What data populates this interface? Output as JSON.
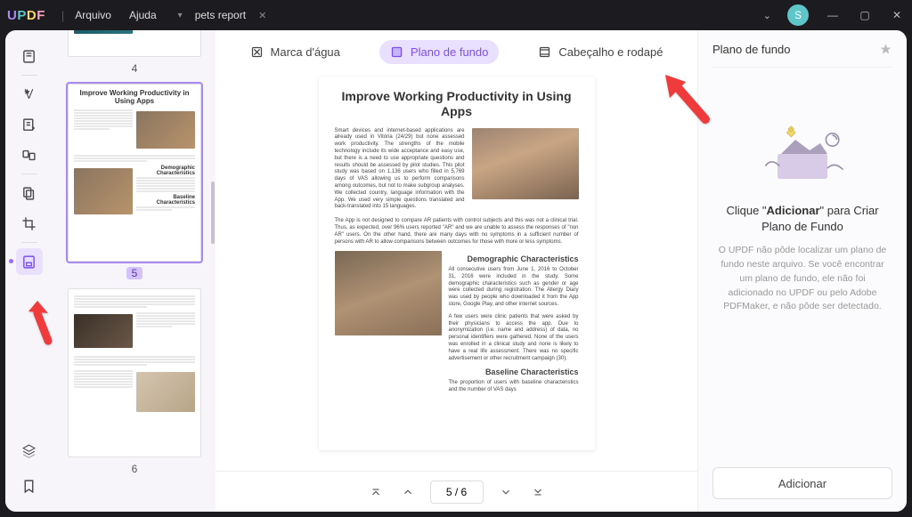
{
  "app": {
    "logo": "UPDF"
  },
  "menu": {
    "arquivo": "Arquivo",
    "ajuda": "Ajuda"
  },
  "tab": {
    "title": "pets report"
  },
  "avatar": {
    "initial": "S"
  },
  "thumbs": {
    "t4": {
      "num": "4"
    },
    "t5": {
      "num": "5",
      "title": "Improve Working Productivity in Using Apps",
      "h2a": "Demographic Characteristics",
      "h2b": "Baseline Characteristics"
    },
    "t6": {
      "num": "6"
    }
  },
  "top_tabs": {
    "watermark": "Marca d'água",
    "background": "Plano de fundo",
    "header_footer": "Cabeçalho e rodapé"
  },
  "doc": {
    "title": "Improve Working Productivity in Using Apps",
    "p1": "Smart devices and internet-based applications are already used in Vitória (24/29) but none assessed work productivity. The strengths of the mobile technology include its wide acceptance and easy use, but there is a need to use appropriate questions and results should be assessed by pilot studies. This pilot study was based on 1,136 users who filled in 5,769 days of VAS allowing us to perform comparisons among outcomes, but not to make subgroup analyses. We collected country, language information with the App. We used very simple questions translated and back-translated into 15 languages.",
    "p2": "The App is not designed to compare AR patients with control subjects and this was not a clinical trial. Thus, as expected, over 96% users reported \"AR\" and we are unable to assess the responses of \"non AR\" users. On the other hand, there are many days with no symptoms in a sufficient number of persons with AR to allow comparisons between outcomes for those with more or less symptoms.",
    "h2a": "Demographic Characteristics",
    "p3": "All consecutive users from June 1, 2016 to October 31, 2016 were included in the study. Some demographic characteristics such as gender or age were collected during registration. The Allergy Diary was used by people who downloaded it from the App store, Google Play, and other internet sources.",
    "p4": "A few users were clinic patients that were asked by their physicians to access the app. Due to anonymization (i.e. name and address) of data, no personal identifiers were gathered. None of the users was enrolled in a clinical study and none is likely to have a real life assessment. There was no specific advertisement or other recruitment campaign (30).",
    "h2b": "Baseline Characteristics",
    "p5": "The proportion of users with baseline characteristics and the number of VAS days"
  },
  "pager": {
    "value": "5 / 6"
  },
  "rpanel": {
    "title": "Plano de fundo",
    "msg_pre": "Clique \"",
    "msg_bold": "Adicionar",
    "msg_post": "\" para Criar Plano de Fundo",
    "sub": "O UPDF não pôde localizar um plano de fundo neste arquivo. Se você encontrar um plano de fundo, ele não foi adicionado no UPDF ou pelo Adobe PDFMaker, e não pôde ser detectado.",
    "btn": "Adicionar"
  }
}
